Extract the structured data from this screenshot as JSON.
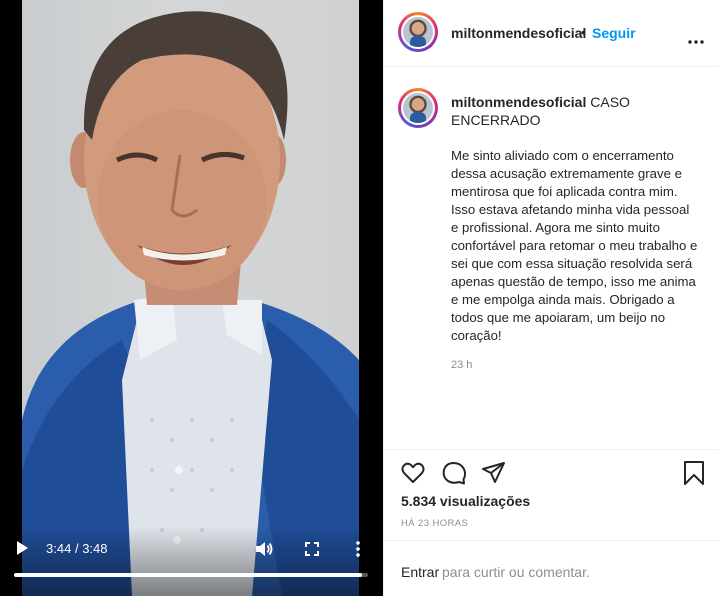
{
  "video": {
    "current_time": "3:44",
    "separator": "/",
    "duration": "3:48",
    "progress": 0.982,
    "icons": [
      "play-icon",
      "volume-icon",
      "fullscreen-icon",
      "more-vertical-icon"
    ]
  },
  "header": {
    "username": "miltonmendesoficial",
    "dot": "•",
    "follow_label": "Seguir"
  },
  "caption": {
    "username": "miltonmendesoficial",
    "title": "CASO ENCERRADO",
    "body": "Me sinto aliviado com o encerramento dessa acusação extremamente grave e mentirosa que foi aplicada contra mim. Isso estava afetando minha vida pessoal e profissional. Agora me sinto muito confortável para retomar o meu trabalho e sei que com essa situação resolvida será apenas questão de tempo, isso me anima e me empolga ainda mais. Obrigado a todos que me apoiaram, um beijo no coração!",
    "time": "23 h"
  },
  "stats": {
    "views": "5.834 visualizações",
    "ago": "HÁ 23 HORAS"
  },
  "comment": {
    "login_label": "Entrar",
    "placeholder": "para curtir ou comentar."
  },
  "colors": {
    "accent": "#0095f6",
    "text": "#262626",
    "muted": "#8e8e8e",
    "border": "#efefef"
  }
}
